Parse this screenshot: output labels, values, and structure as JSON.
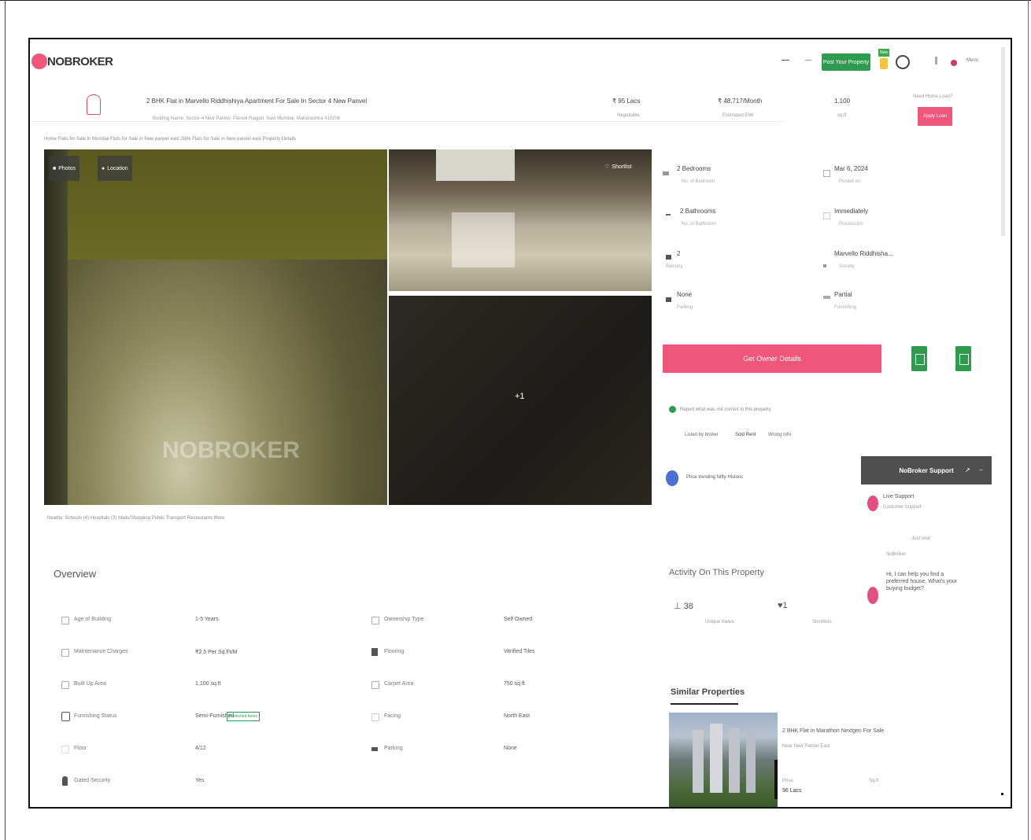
{
  "header": {
    "logo_text": "NOBROKER",
    "post_button": "Post Your Property",
    "new_badge": "New",
    "menu_label": "Menu"
  },
  "listing": {
    "title": "2 BHK Flat in Marvello Riddhishiya Apartment For Sale In Sector 4 New Panvel",
    "subtitle": "Building Name, Sector-4 New Panvel, Panvel Raigad, Navi Mumbai, Maharashtra 410206",
    "price": "₹ 95 Lacs",
    "price_sub": "Negotiable",
    "emi": "₹ 48,717/Month",
    "emi_sub": "Estimated EMI",
    "area": "1,100",
    "area_sub": "sq.ft",
    "contact_prompt": "Need Home Loan?",
    "apply_button": "Apply Loan"
  },
  "breadcrumb": "Home  Flats for Sale in Mumbai  Flats for Sale in New panvel east  2bhk Flats for Sale in New panvel east  Property Details",
  "gallery": {
    "photos_btn": "Photos",
    "location_btn": "Location",
    "shortlist_btn": "Shortlist",
    "more_count": "+1",
    "watermark": "NOBROKER"
  },
  "nearby_links": "Nearby:  Schools (4)   Hospitals (3)   Malls/Shopping   Public Transport   Restaurants   More",
  "specs": {
    "left": [
      {
        "title": "2 Bedrooms",
        "sub": "No. of Bedroom"
      },
      {
        "title": "2 Bathrooms",
        "sub": "No. of Bathroom"
      },
      {
        "title": "2",
        "sub": "Balcony"
      },
      {
        "title": "None",
        "sub": "Parking"
      }
    ],
    "right": [
      {
        "title": "Mar 6, 2024",
        "sub": "Posted on"
      },
      {
        "title": "Immediately",
        "sub": "Possession"
      },
      {
        "title": "Marvello Riddhisha...",
        "sub": "Society"
      },
      {
        "title": "Partial",
        "sub": "Furnishing"
      }
    ]
  },
  "actions": {
    "get_owner": "Get Owner Details",
    "report_text": "Report what was not correct in this property",
    "report_options": [
      "Listed by broker",
      "Sold Rent",
      "Wrong info"
    ],
    "price_label": "Price trending Nifty Historic"
  },
  "support": {
    "header": "NoBroker Support",
    "agent_name": "Live Support",
    "agent_sub": "Customer Support",
    "time": "Just now",
    "sender": "NoBroker",
    "message": "Hi, I can help you find a preferred house. What's your buying budget?"
  },
  "overview": {
    "title": "Overview",
    "rows": [
      {
        "l_label": "Age of Building",
        "l_value": "1-5 Years",
        "r_label": "Ownership Type",
        "r_value": "Self Owned"
      },
      {
        "l_label": "Maintenance Charges",
        "l_value": "₹2.5 Per Sq.Ft/M",
        "r_label": "Flooring",
        "r_value": "Vitrified Tiles"
      },
      {
        "l_label": "Built Up Area",
        "l_value": "1,100 sq.ft",
        "r_label": "Carpet Area",
        "r_value": "750 sq.ft"
      },
      {
        "l_label": "Furnishing Status",
        "l_value": "Semi-Furnished",
        "r_label": "Facing",
        "r_value": "North East"
      },
      {
        "l_label": "Floor",
        "l_value": "4/12",
        "r_label": "Parking",
        "r_value": "None"
      },
      {
        "l_label": "Gated Security",
        "l_value": "Yes",
        "r_label": "",
        "r_value": ""
      }
    ],
    "furnish_tag": "Furnished Items"
  },
  "activity": {
    "title": "Activity On This Property",
    "views": "38",
    "views_label": "Unique Views",
    "shortlists": "1",
    "shortlists_label": "Shortlists"
  },
  "similar": {
    "title": "Similar Properties",
    "card_title": "2 BHK Flat in Marathon Nextgen For Sale",
    "card_sub": "Near New Panvel East",
    "card_price_label": "Price",
    "card_price": "96 Lacs",
    "card_area_label": "Sq.ft"
  }
}
